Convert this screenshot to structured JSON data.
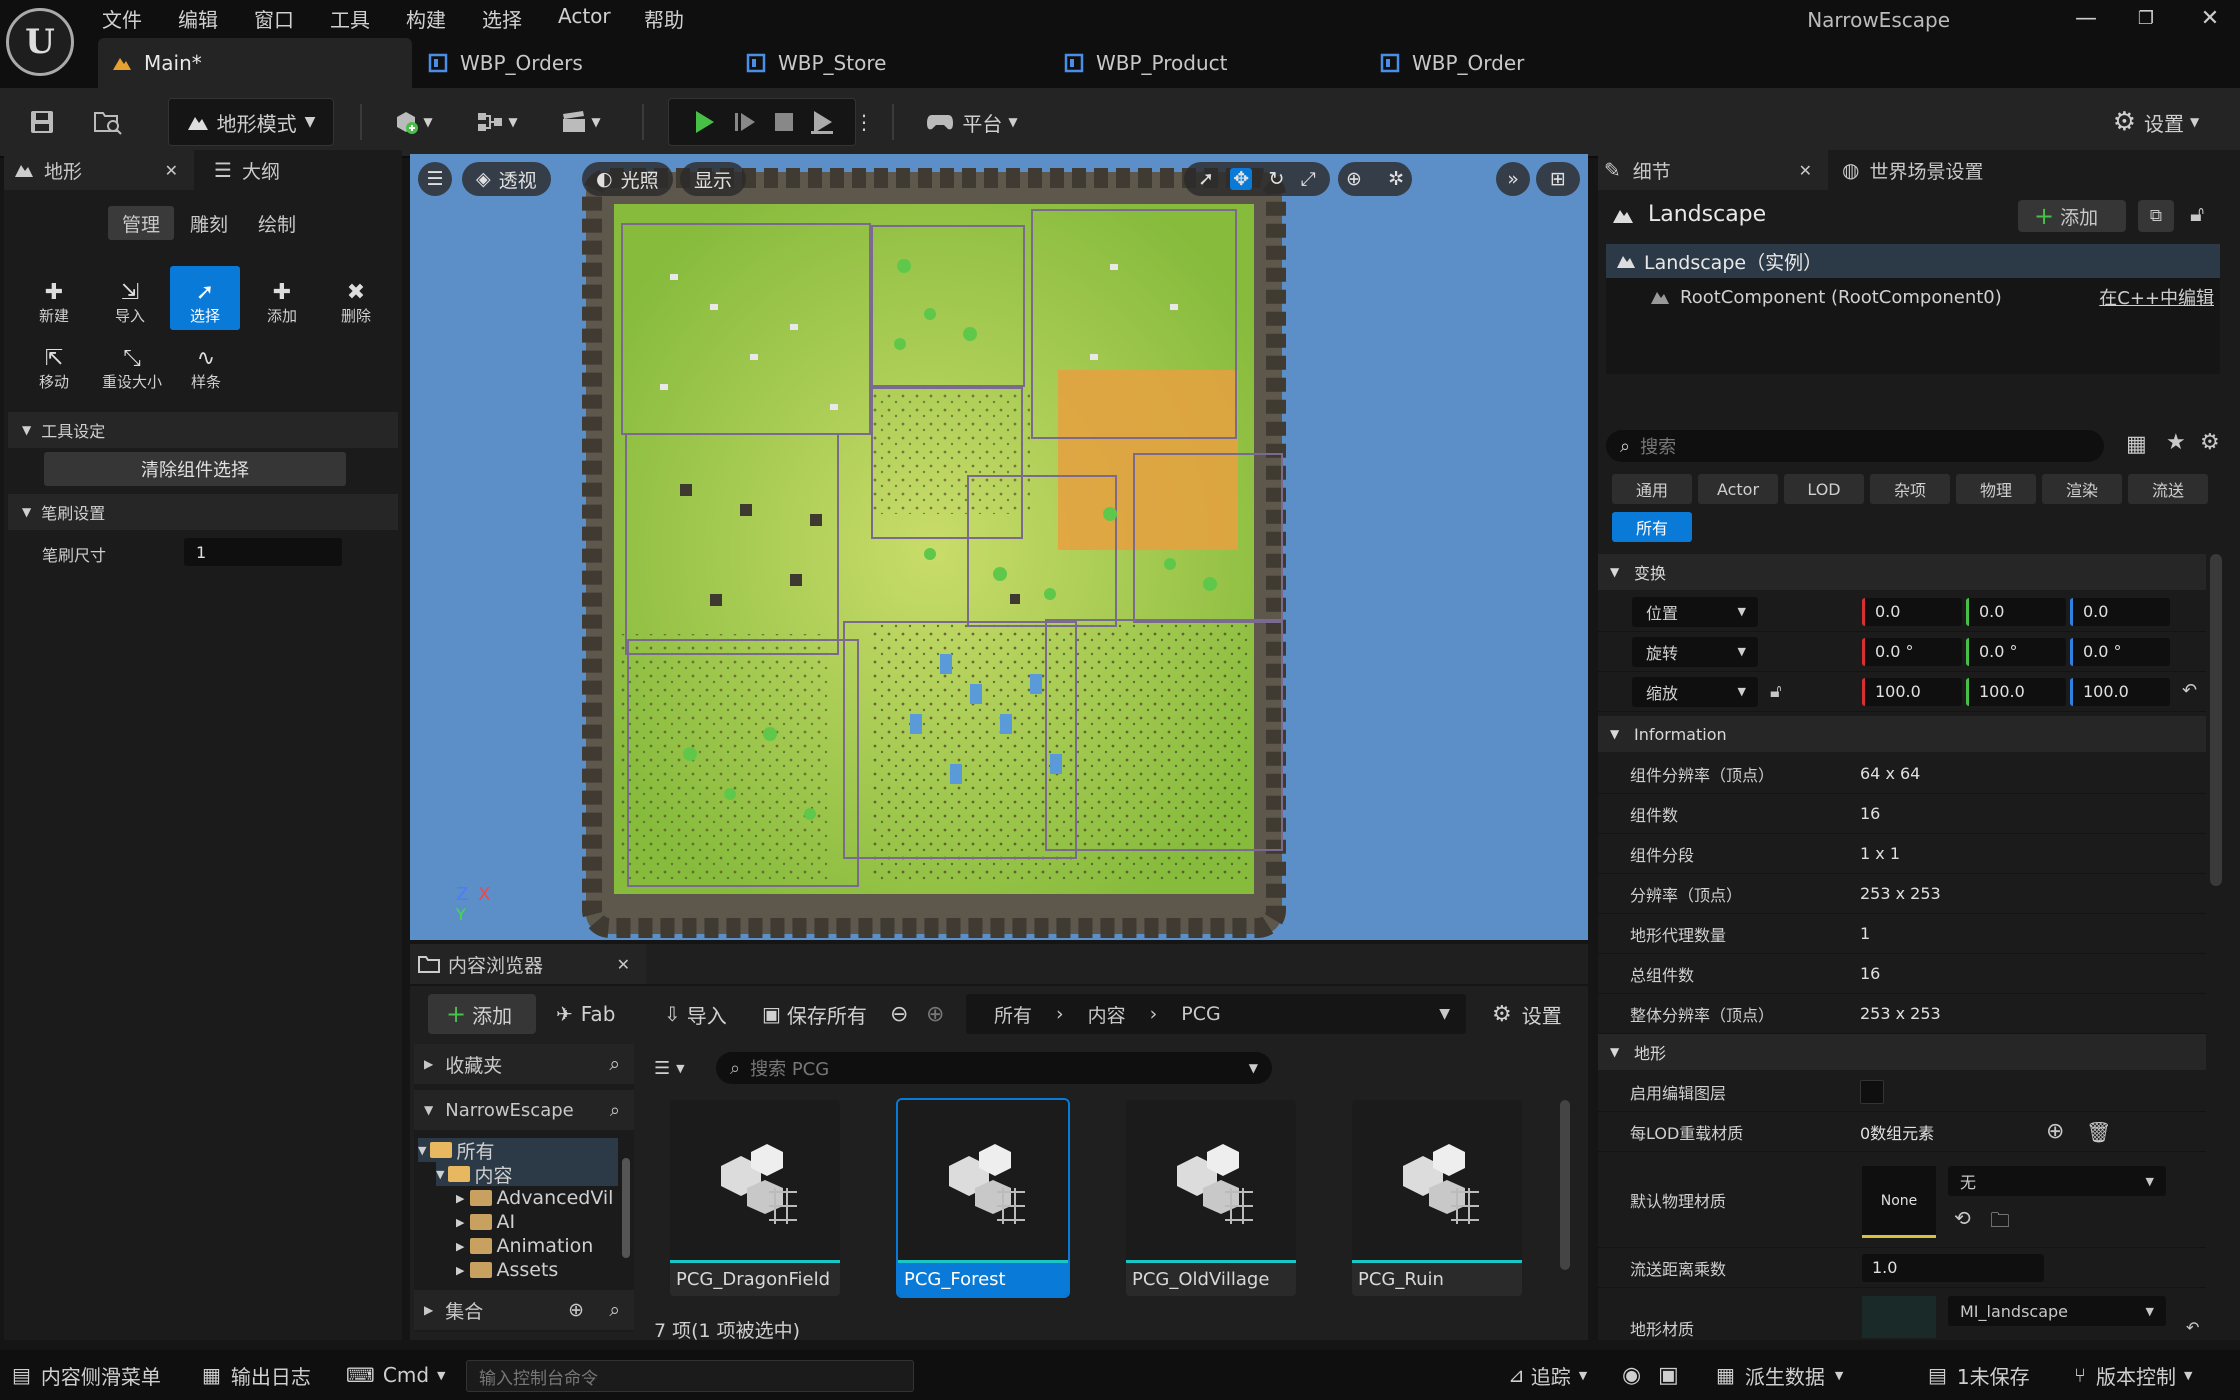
{
  "app": {
    "logo": "U",
    "window_title": "NarrowEscape",
    "menu": [
      "文件",
      "编辑",
      "窗口",
      "工具",
      "构建",
      "选择",
      "Actor",
      "帮助"
    ],
    "window_controls": [
      "—",
      "❐",
      "✕"
    ]
  },
  "doc_tabs": [
    {
      "label": "Main*",
      "active": true
    },
    {
      "label": "WBP_Orders"
    },
    {
      "label": "WBP_Store"
    },
    {
      "label": "WBP_Product"
    },
    {
      "label": "WBP_Order"
    }
  ],
  "toolbar": {
    "mode_label": "地形模式",
    "platform_label": "平台",
    "settings_label": "设置"
  },
  "left_panel": {
    "tabs": [
      "地形",
      "大纲"
    ],
    "subtabs": [
      "管理",
      "雕刻",
      "绘制"
    ],
    "tools": [
      {
        "label": "新建",
        "icon": "new-icon"
      },
      {
        "label": "导入",
        "icon": "import-icon"
      },
      {
        "label": "选择",
        "icon": "select-icon",
        "selected": true
      },
      {
        "label": "添加",
        "icon": "add-icon"
      },
      {
        "label": "删除",
        "icon": "delete-icon"
      },
      {
        "label": "移动",
        "icon": "move-icon"
      },
      {
        "label": "重设大小",
        "icon": "resize-icon"
      },
      {
        "label": "样条",
        "icon": "spline-icon"
      }
    ],
    "tool_settings_header": "工具设定",
    "clear_selection_button": "清除组件选择",
    "brush_settings_header": "笔刷设置",
    "brush_size_label": "笔刷尺寸",
    "brush_size_value": "1"
  },
  "viewport": {
    "perspective_label": "透视",
    "lighting_label": "光照",
    "show_label": "显示",
    "axis_z": "Z",
    "axis_x": "X",
    "axis_y": "Y"
  },
  "content_browser": {
    "tab_label": "内容浏览器",
    "add_label": "添加",
    "fab_label": "Fab",
    "import_label": "导入",
    "save_all_label": "保存所有",
    "settings_label": "设置",
    "breadcrumb": [
      "所有",
      "内容",
      "PCG"
    ],
    "favorites_label": "收藏夹",
    "project_label": "NarrowEscape",
    "search_placeholder": "搜索 PCG",
    "tree": [
      "所有",
      "内容",
      "AdvancedVil",
      "AI",
      "Animation",
      "Assets"
    ],
    "collections_label": "集合",
    "assets": [
      {
        "name": "PCG_DragonField"
      },
      {
        "name": "PCG_Forest",
        "selected": true
      },
      {
        "name": "PCG_OldVillage"
      },
      {
        "name": "PCG_Ruin"
      }
    ],
    "status": "7 项(1 项被选中)"
  },
  "details": {
    "tabs": [
      "细节",
      "世界场景设置"
    ],
    "actor_name": "Landscape",
    "add_button": "添加",
    "instance_label": "Landscape（实例）",
    "root_component": "RootComponent (RootComponent0)",
    "edit_cpp": "在C++中编辑",
    "search_placeholder": "搜索",
    "filters": [
      "通用",
      "Actor",
      "LOD",
      "杂项",
      "物理",
      "渲染",
      "流送",
      "所有"
    ],
    "transform_header": "变换",
    "transform": [
      {
        "label": "位置",
        "values": [
          "0.0",
          "0.0",
          "0.0"
        ]
      },
      {
        "label": "旋转",
        "values": [
          "0.0 °",
          "0.0 °",
          "0.0 °"
        ]
      },
      {
        "label": "缩放",
        "values": [
          "100.0",
          "100.0",
          "100.0"
        ]
      }
    ],
    "information_header": "Information",
    "information": [
      {
        "name": "组件分辨率（顶点）",
        "value": "64 x 64"
      },
      {
        "name": "组件数",
        "value": "16"
      },
      {
        "name": "组件分段",
        "value": "1 x 1"
      },
      {
        "name": "分辨率（顶点）",
        "value": "253 x 253"
      },
      {
        "name": "地形代理数量",
        "value": "1"
      },
      {
        "name": "总组件数",
        "value": "16"
      },
      {
        "name": "整体分辨率（顶点）",
        "value": "253 x 253"
      }
    ],
    "landscape_header": "地形",
    "enable_edit_layers": "启用编辑图层",
    "lod_material_label": "每LOD重载材质",
    "lod_material_value": "0数组元素",
    "phys_material_label": "默认物理材质",
    "phys_material_thumb": "None",
    "phys_material_value": "无",
    "stream_distance_label": "流送距离乘数",
    "stream_distance_value": "1.0",
    "landscape_material_label": "地形材质",
    "landscape_material_value": "MI_landscape"
  },
  "statusbar": {
    "content_drawer": "内容侧滑菜单",
    "output_log": "输出日志",
    "cmd": "Cmd",
    "console_placeholder": "输入控制台命令",
    "trace": "追踪",
    "derived_data": "派生数据",
    "unsaved": "1未保存",
    "source_control": "版本控制"
  },
  "colors": {
    "accent": "#0a7ad8",
    "play_green": "#48c048",
    "landscape_green": "#8ec63f",
    "sky_blue": "#5c8fc7"
  }
}
